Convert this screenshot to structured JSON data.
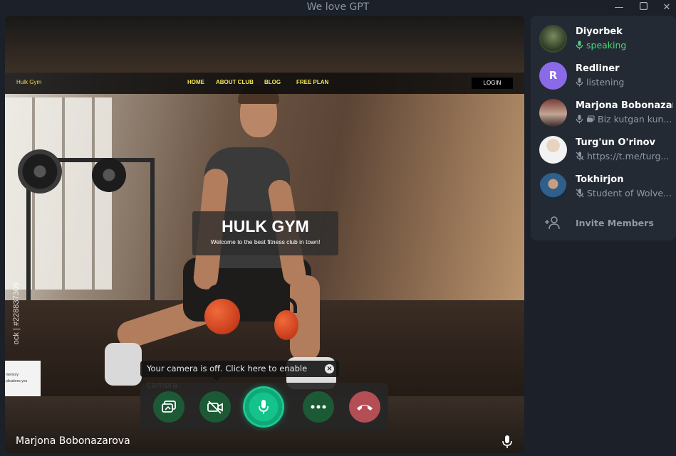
{
  "window": {
    "title": "We love GPT",
    "controls": [
      "minimize",
      "maximize",
      "close"
    ]
  },
  "website": {
    "brand": "Hulk Gym",
    "nav": [
      "HOME",
      "ABOUT CLUB",
      "BLOG",
      "FREE PLAN"
    ],
    "login": "LOGIN",
    "hero_title": "HULK GYM",
    "hero_subtitle": "Welcome to the best fitness club in town!",
    "watermark": "ock | #228837309",
    "popup_lines": [
      "memory",
      "plications you"
    ]
  },
  "call": {
    "camera_tooltip": "Your camera is off. Click here to enable camera.",
    "speaker_name": "Marjona Bobonazarova",
    "buttons": [
      {
        "name": "screen-share",
        "icon": "screen-share-icon"
      },
      {
        "name": "camera",
        "icon": "camera-off-icon"
      },
      {
        "name": "microphone",
        "icon": "microphone-icon"
      },
      {
        "name": "more",
        "icon": "more-icon"
      },
      {
        "name": "leave",
        "icon": "hang-up-icon"
      }
    ]
  },
  "members": [
    {
      "name": "Diyorbek",
      "status": "speaking",
      "status_icon": "microphone-icon",
      "state": "speaking",
      "avatar": "photo"
    },
    {
      "name": "Redliner",
      "status": "listening",
      "status_icon": "microphone-icon",
      "state": "listening",
      "avatar": "R",
      "avatar_color": "#8b6ae8"
    },
    {
      "name": "Marjona Bobonazarova",
      "status": "Biz kutgan kun...",
      "status_icon": "microphone-video-icon",
      "state": "listening",
      "avatar": "photo"
    },
    {
      "name": "Turg'un O'rinov",
      "status": "https://t.me/turg...",
      "status_icon": "microphone-muted-icon",
      "state": "muted",
      "avatar": "photo"
    },
    {
      "name": "Tokhirjon",
      "status": "Student of Wolve...",
      "status_icon": "microphone-muted-icon",
      "state": "muted",
      "avatar": "photo"
    }
  ],
  "invite_label": "Invite Members",
  "colors": {
    "speaking": "#4cd679",
    "mic_active": "#13c38a",
    "hangup": "#b44e55",
    "panel_bg": "#232a33"
  }
}
